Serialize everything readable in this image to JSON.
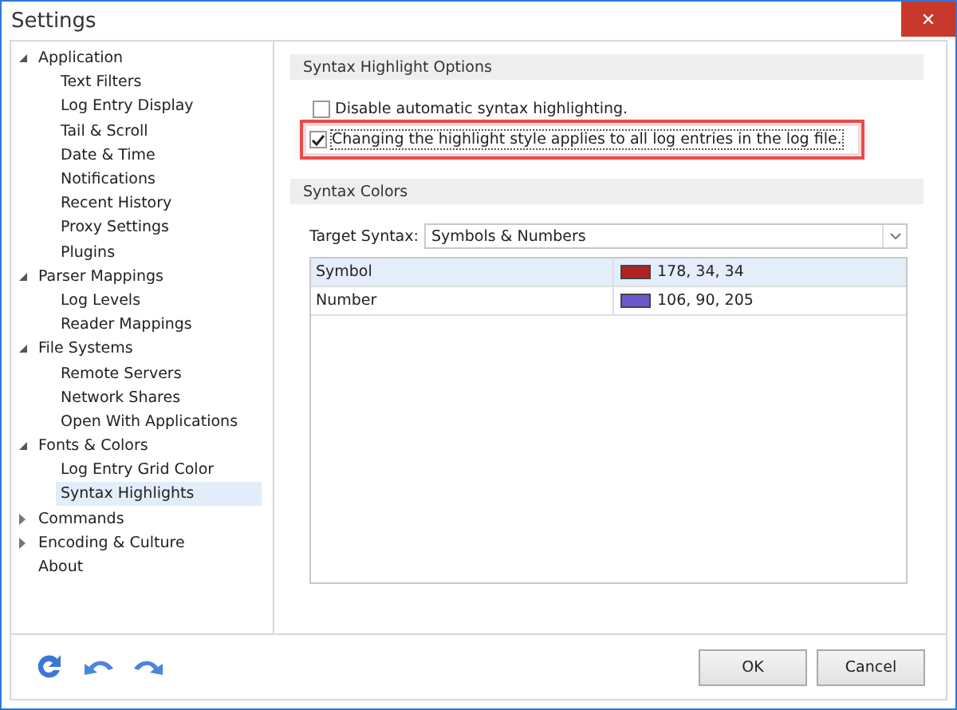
{
  "window": {
    "title": "Settings",
    "close": "✕"
  },
  "tree": [
    {
      "label": "Application",
      "expanded": true,
      "selected": false,
      "children": [
        {
          "label": "Text Filters",
          "selected": false
        },
        {
          "label": "Log Entry Display",
          "selected": false
        },
        {
          "label": "Tail & Scroll",
          "selected": false
        },
        {
          "label": "Date & Time",
          "selected": false
        },
        {
          "label": "Notifications",
          "selected": false
        },
        {
          "label": "Recent History",
          "selected": false
        },
        {
          "label": "Proxy Settings",
          "selected": false
        },
        {
          "label": "Plugins",
          "selected": false
        }
      ]
    },
    {
      "label": "Parser Mappings",
      "expanded": true,
      "selected": false,
      "children": [
        {
          "label": "Log Levels",
          "selected": false
        },
        {
          "label": "Reader Mappings",
          "selected": false
        }
      ]
    },
    {
      "label": "File Systems",
      "expanded": true,
      "selected": false,
      "children": [
        {
          "label": "Remote Servers",
          "selected": false
        },
        {
          "label": "Network Shares",
          "selected": false
        },
        {
          "label": "Open With Applications",
          "selected": false
        }
      ]
    },
    {
      "label": "Fonts & Colors",
      "expanded": true,
      "selected": false,
      "children": [
        {
          "label": "Log Entry Grid Color",
          "selected": false
        },
        {
          "label": "Syntax Highlights",
          "selected": true
        }
      ]
    },
    {
      "label": "Commands",
      "expanded": false,
      "selected": false
    },
    {
      "label": "Encoding & Culture",
      "expanded": false,
      "selected": false
    },
    {
      "label": "About",
      "selected": false
    }
  ],
  "options_section": {
    "title": "Syntax Highlight Options",
    "options": [
      {
        "label": "Disable automatic syntax highlighting.",
        "checked": false,
        "highlighted": false
      },
      {
        "label": "Changing the highlight style applies to all log entries in the log file.",
        "checked": true,
        "highlighted": true
      }
    ]
  },
  "colors_section": {
    "title": "Syntax Colors",
    "target_label": "Target Syntax:",
    "target_value": "Symbols & Numbers",
    "rows": [
      {
        "name": "Symbol",
        "color": "#b22222",
        "value": "178, 34, 34",
        "selected": true
      },
      {
        "name": "Number",
        "color": "#6a5acd",
        "value": "106, 90, 205",
        "selected": false
      }
    ]
  },
  "buttons": [
    "OK",
    "Cancel"
  ]
}
